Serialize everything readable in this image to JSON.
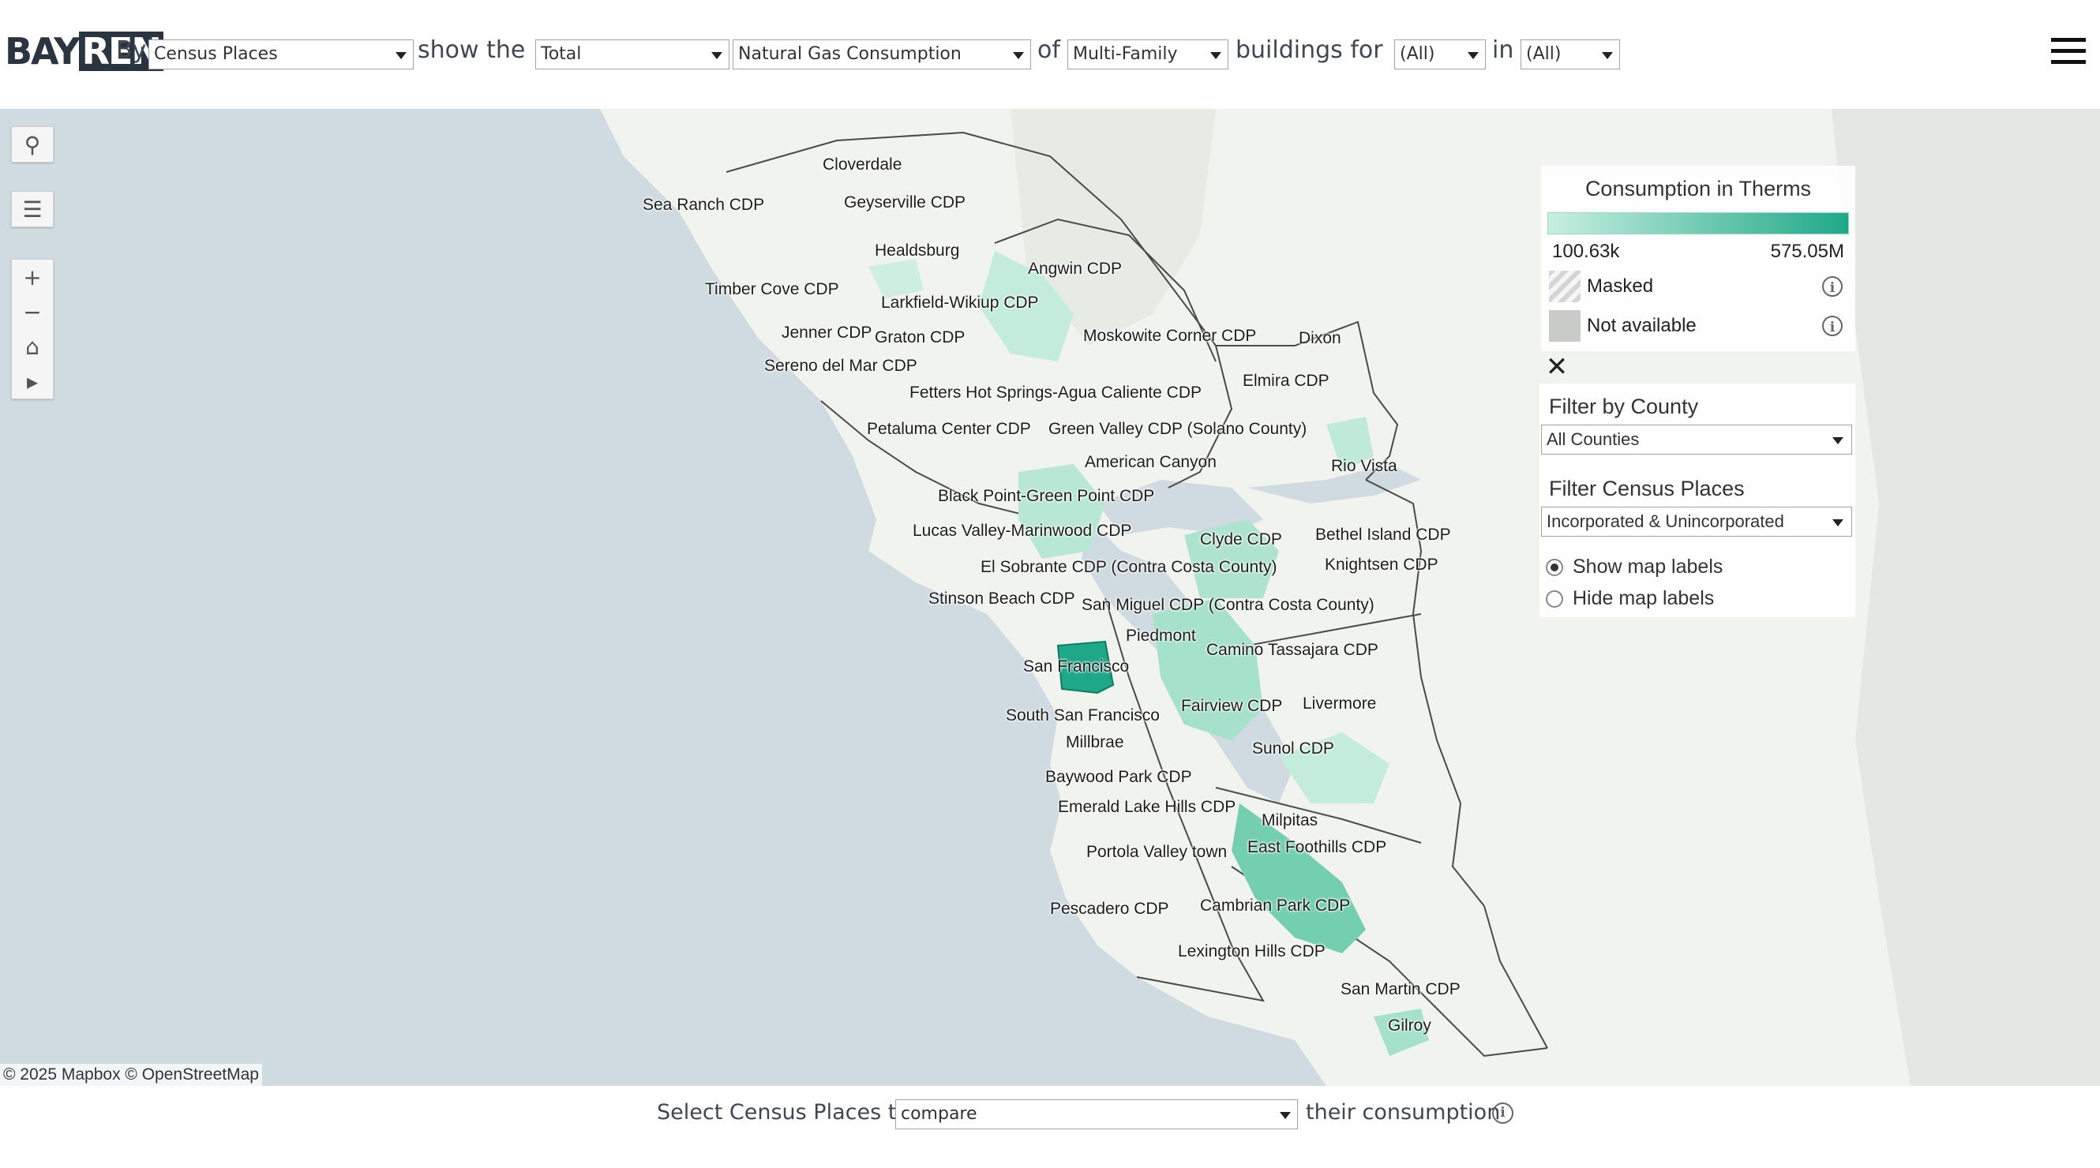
{
  "header": {
    "logo_part1": "BAY",
    "logo_part2": "REN",
    "by_label": "By",
    "geography_select": "Census Places",
    "show_the_label": "show the",
    "measure_select": "Total",
    "metric_select": "Natural Gas Consumption",
    "of_label": "of",
    "building_select": "Multi-Family",
    "buildings_for_label": "buildings for",
    "for_select": "(All)",
    "in_label": "in",
    "in_select": "(All)"
  },
  "map": {
    "attribution": "© 2025 Mapbox  © OpenStreetMap",
    "labels": [
      "Cloverdale",
      "Sea Ranch CDP",
      "Geyserville CDP",
      "Healdsburg",
      "Angwin CDP",
      "Timber Cove CDP",
      "Larkfield-Wikiup CDP",
      "Jenner CDP",
      "Graton CDP",
      "Moskowite Corner CDP",
      "Dixon",
      "Sereno del Mar CDP",
      "Elmira CDP",
      "Fetters Hot Springs-Agua Caliente CDP",
      "Petaluma Center CDP",
      "Green Valley CDP (Solano County)",
      "American Canyon",
      "Rio Vista",
      "Black Point-Green Point CDP",
      "Lucas Valley-Marinwood CDP",
      "Clyde CDP",
      "Bethel Island CDP",
      "El Sobrante CDP (Contra Costa County)",
      "Knightsen CDP",
      "Stinson Beach CDP",
      "San Miguel CDP (Contra Costa County)",
      "Piedmont",
      "Camino Tassajara CDP",
      "San Francisco",
      "South San Francisco",
      "Fairview CDP",
      "Livermore",
      "Millbrae",
      "Sunol CDP",
      "Baywood Park CDP",
      "Emerald Lake Hills CDP",
      "Milpitas",
      "Portola Valley town",
      "East Foothills CDP",
      "Pescadero CDP",
      "Cambrian Park CDP",
      "Lexington Hills CDP",
      "San Martin CDP",
      "Gilroy"
    ]
  },
  "legend": {
    "title": "Consumption in Therms",
    "min": "100.63k",
    "max": "575.05M",
    "masked_label": "Masked",
    "na_label": "Not available",
    "ramp_low_color": "#c8efe0",
    "ramp_high_color": "#1fa888"
  },
  "filters": {
    "county_title": "Filter by County",
    "county_value": "All Counties",
    "places_title": "Filter Census Places",
    "places_value": "Incorporated & Unincorporated",
    "show_labels": "Show map labels",
    "hide_labels": "Hide map labels"
  },
  "footer": {
    "select_label": "Select Census Places to",
    "compare_value": "compare",
    "their_label": "their consumption"
  }
}
